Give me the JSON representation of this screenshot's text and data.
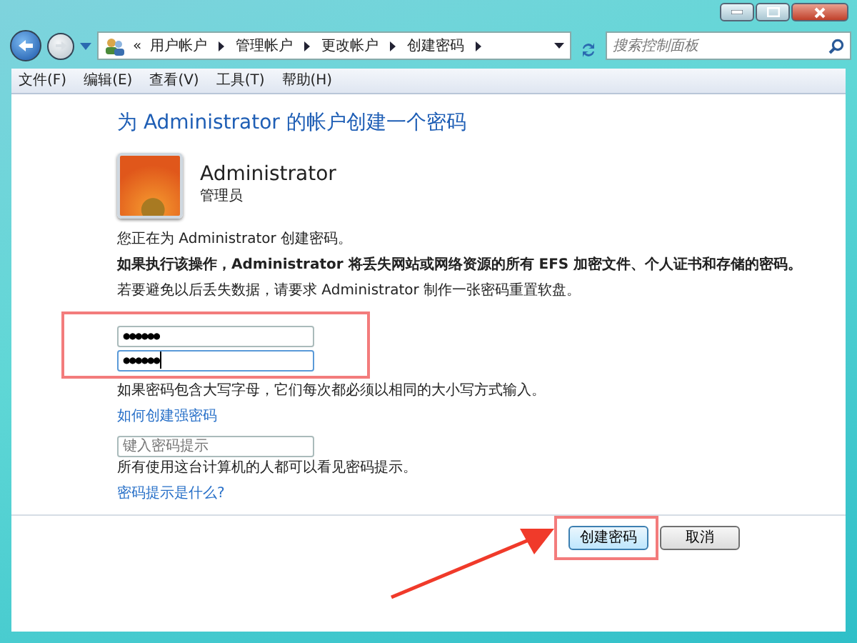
{
  "breadcrumbs": [
    {
      "label": "用户帐户"
    },
    {
      "label": "管理帐户"
    },
    {
      "label": "更改帐户"
    },
    {
      "label": "创建密码"
    }
  ],
  "breadcrumb_overflow": "«",
  "search": {
    "placeholder": "搜索控制面板"
  },
  "menu": [
    {
      "label": "文件(F)"
    },
    {
      "label": "编辑(E)"
    },
    {
      "label": "查看(V)"
    },
    {
      "label": "工具(T)"
    },
    {
      "label": "帮助(H)"
    }
  ],
  "heading": "为 Administrator 的帐户创建一个密码",
  "account": {
    "name": "Administrator",
    "role": "管理员"
  },
  "notes": [
    {
      "text": "您正在为 Administrator 创建密码。",
      "bold": false
    },
    {
      "text": "如果执行该操作，Administrator 将丢失网站或网络资源的所有 EFS 加密文件、个人证书和存储的密码。",
      "bold": true
    },
    {
      "text": "若要避免以后丢失数据，请要求 Administrator 制作一张密码重置软盘。",
      "bold": false
    }
  ],
  "password_fields": [
    {
      "value": "●●●●●●",
      "focused": false
    },
    {
      "value": "●●●●●●",
      "focused": true
    }
  ],
  "case_note": "如果密码包含大写字母，它们每次都必须以相同的大小写方式输入。",
  "strong_password_link": "如何创建强密码",
  "hint_field": {
    "placeholder": "键入密码提示"
  },
  "hint_note": "所有使用这台计算机的人都可以看见密码提示。",
  "hint_link": "密码提示是什么?",
  "buttons": [
    {
      "label": "创建密码",
      "highlighted": true
    },
    {
      "label": "取消",
      "highlighted": false
    }
  ]
}
